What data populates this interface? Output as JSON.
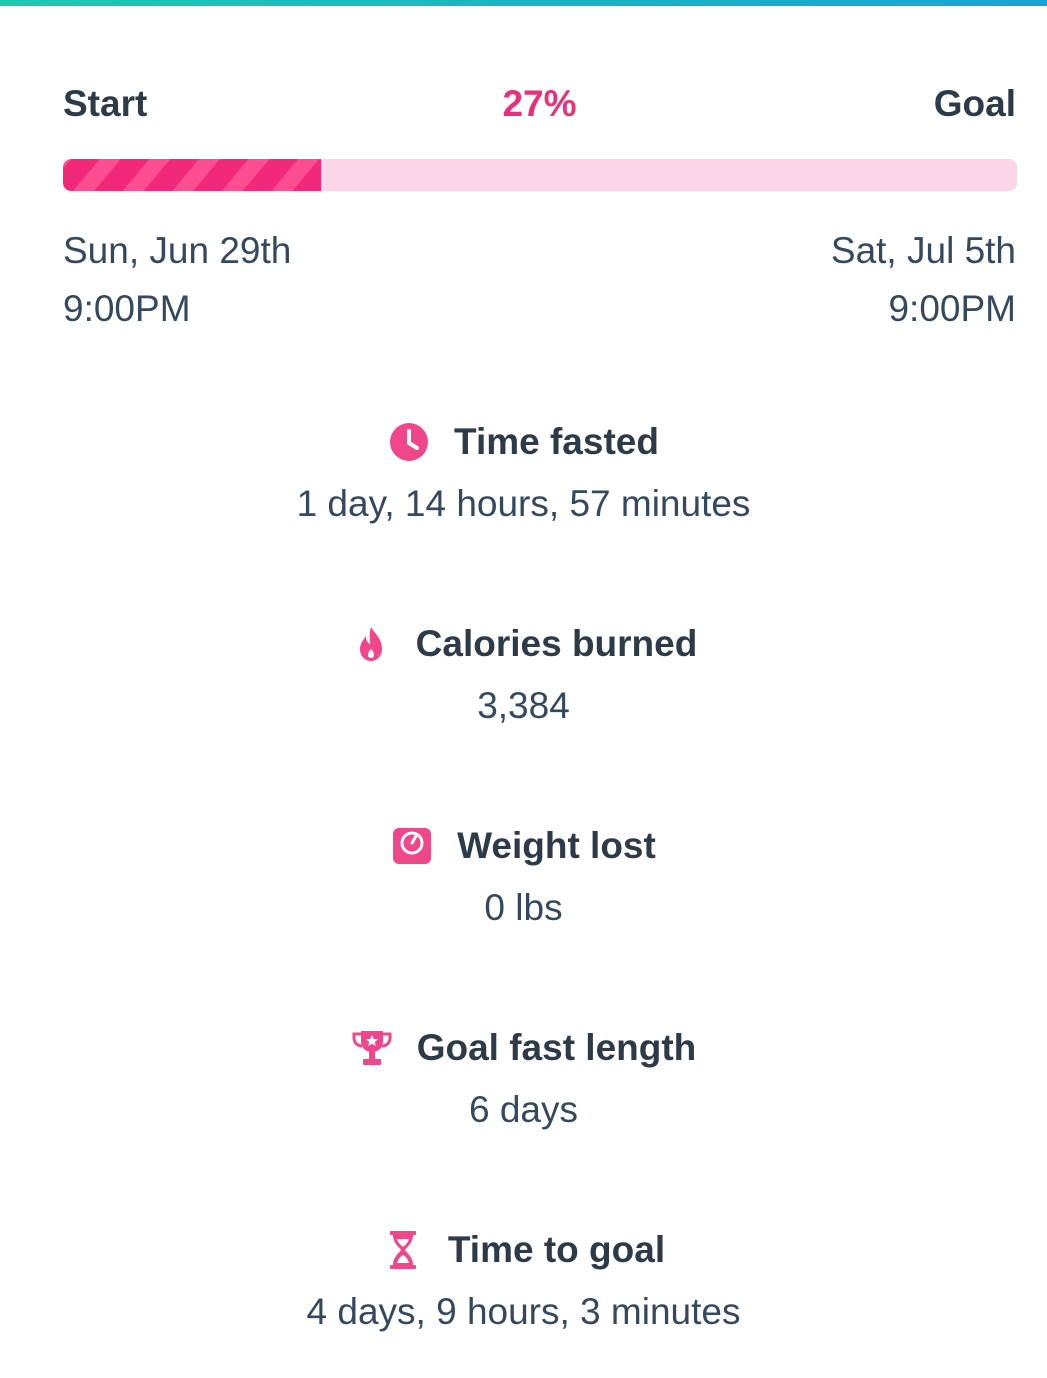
{
  "progress": {
    "start_label": "Start",
    "goal_label": "Goal",
    "percent_text": "27%",
    "percent_value": 0.27,
    "fill_color": "#f2297a",
    "track_color": "#fdd7e7",
    "start_date": "Sun, Jun 29th",
    "start_time": "9:00PM",
    "goal_date": "Sat, Jul 5th",
    "goal_time": "9:00PM"
  },
  "stats": [
    {
      "icon": "clock-icon",
      "title": "Time fasted",
      "value": "1 day, 14 hours, 57 minutes"
    },
    {
      "icon": "flame-icon",
      "title": "Calories burned",
      "value": "3,384"
    },
    {
      "icon": "scale-icon",
      "title": "Weight lost",
      "value": "0 lbs"
    },
    {
      "icon": "trophy-icon",
      "title": "Goal fast length",
      "value": "6 days"
    },
    {
      "icon": "hourglass-icon",
      "title": "Time to goal",
      "value": "4 days, 9 hours, 3 minutes"
    }
  ],
  "colors": {
    "accent": "#e8317a",
    "icon": "#f0468a",
    "text_dark": "#2d3b48",
    "text_value": "#34495e"
  }
}
